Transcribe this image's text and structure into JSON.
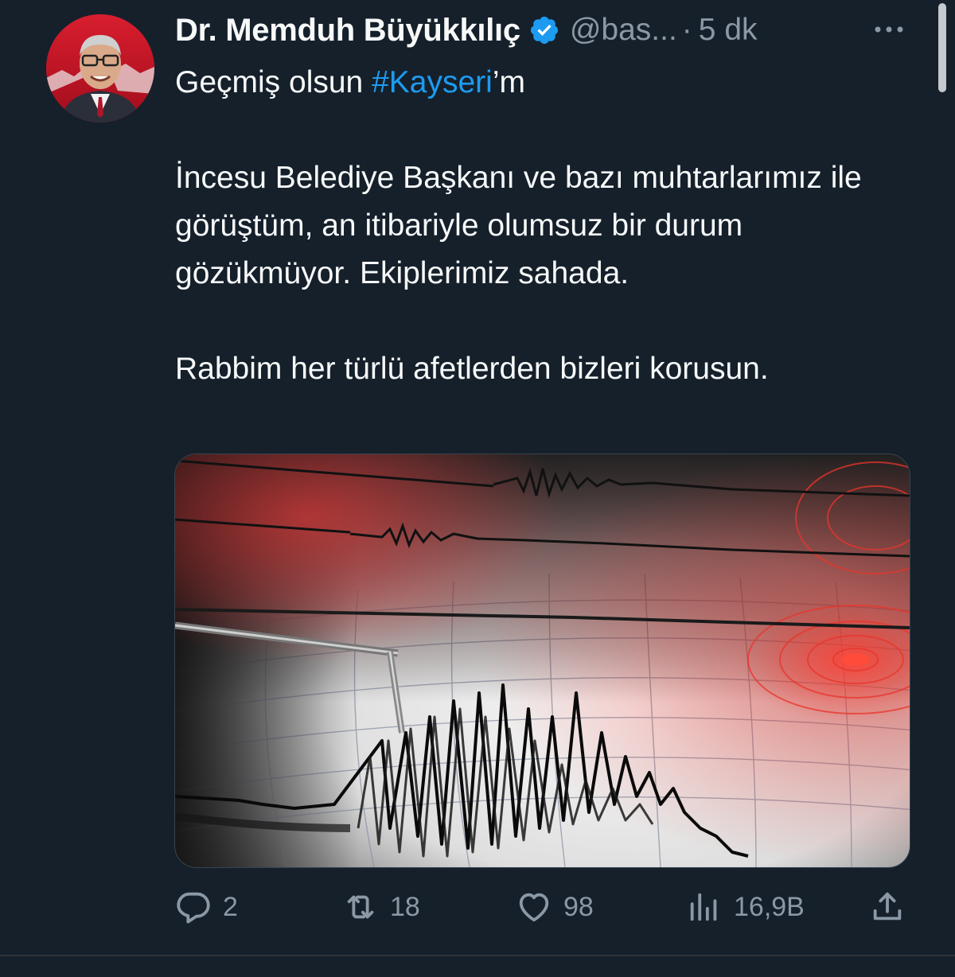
{
  "tweet": {
    "author_name": "Dr. Memduh Büyükkılıç",
    "handle": "@bas...",
    "separator": "·",
    "time": "5 dk",
    "text_prefix": "Geçmiş olsun ",
    "hashtag": "#Kayseri",
    "text_suffix": "’m",
    "paragraph_2": "İncesu Belediye Başkanı ve bazı muhtarlarımız ile görüştüm, an itibariyle olumsuz bir durum gözükmüyor. Ekiplerimiz sahada.",
    "paragraph_3": "Rabbim her türlü afetlerden bizleri korusun."
  },
  "stats": {
    "replies": "2",
    "retweets": "18",
    "likes": "98",
    "views": "16,9B"
  },
  "colors": {
    "background": "#15202b",
    "text": "#f7f9f9",
    "secondary": "#8b98a5",
    "accent": "#1d9bf0"
  },
  "icons": [
    "verified-badge-icon",
    "more-icon",
    "reply-icon",
    "retweet-icon",
    "like-icon",
    "views-icon",
    "share-icon"
  ]
}
